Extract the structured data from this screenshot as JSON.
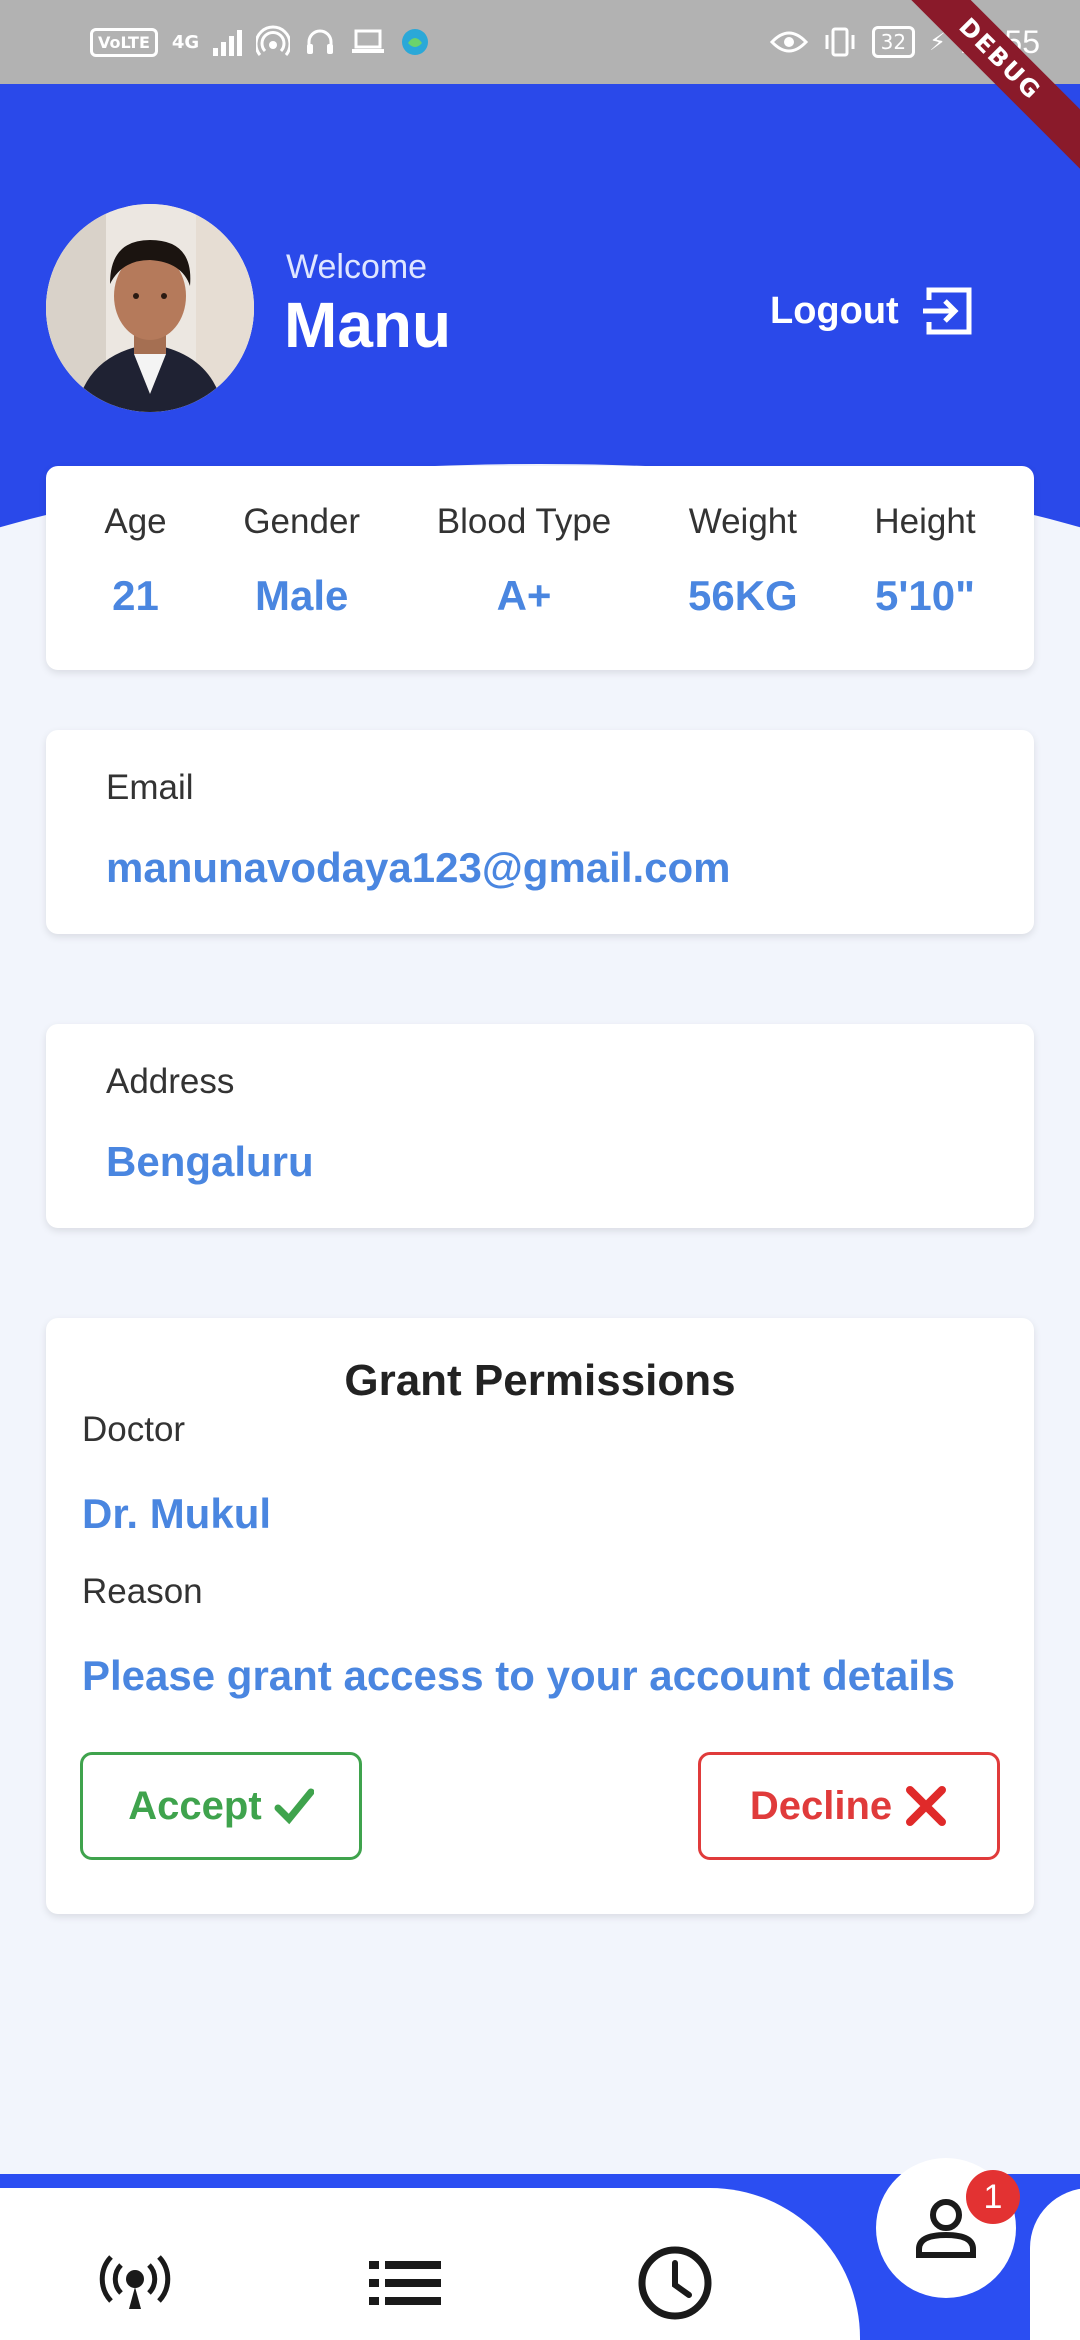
{
  "status_bar": {
    "volte": "VoLTE",
    "network": "4G",
    "battery": "32",
    "time": "10:55",
    "debug": "DEBUG"
  },
  "header": {
    "welcome": "Welcome",
    "name": "Manu",
    "logout_label": "Logout"
  },
  "stats": [
    {
      "label": "Age",
      "value": "21"
    },
    {
      "label": "Gender",
      "value": "Male"
    },
    {
      "label": "Blood Type",
      "value": "A+"
    },
    {
      "label": "Weight",
      "value": "56KG"
    },
    {
      "label": "Height",
      "value": "5'10\""
    }
  ],
  "email": {
    "label": "Email",
    "value": "manunavodaya123@gmail.com"
  },
  "address": {
    "label": "Address",
    "value": "Bengaluru"
  },
  "permissions": {
    "title": "Grant Permissions",
    "doctor_label": "Doctor",
    "doctor_value": "Dr. Mukul",
    "reason_label": "Reason",
    "reason_value": "Please grant access to your account details",
    "accept_label": "Accept",
    "decline_label": "Decline"
  },
  "bottom_nav": {
    "items": [
      "broadcast-icon",
      "list-icon",
      "history-icon",
      "profile-icon"
    ],
    "badge_count": "1"
  },
  "colors": {
    "primary": "#2b4ef2",
    "value_text": "#4a86e0",
    "accept": "#3fa34d",
    "decline": "#e03b3b"
  }
}
